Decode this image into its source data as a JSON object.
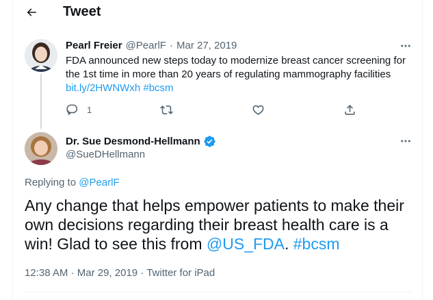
{
  "header": {
    "title": "Tweet",
    "back_icon": "arrow-left-icon"
  },
  "parent_tweet": {
    "author_name": "Pearl Freier",
    "author_handle": "@PearlF",
    "separator": "·",
    "date": "Mar 27, 2019",
    "text": "FDA announced new steps today to modernize breast cancer screening for the 1st time in more than 20 years of regulating mammography facilities",
    "link": "bit.ly/2HWNWxh",
    "hashtag": "#bcsm",
    "reply_count": "1"
  },
  "main_tweet": {
    "author_name": "Dr. Sue Desmond-Hellmann",
    "author_handle": "@SueDHellmann",
    "replying_label": "Replying to",
    "replying_to": "@PearlF",
    "text_main": "Any change that helps empower patients to make their own decisions regarding their breast health care is a win! Glad to see this from ",
    "mention": "@US_FDA",
    "text_dot": ".",
    "hashtag": "#bcsm",
    "time": "12:38 AM",
    "date": "Mar 29, 2019",
    "source": "Twitter for iPad",
    "verified_color": "#1d9bf0"
  },
  "colors": {
    "accent": "#1d9bf0",
    "text": "#0f1419",
    "muted": "#536471"
  }
}
